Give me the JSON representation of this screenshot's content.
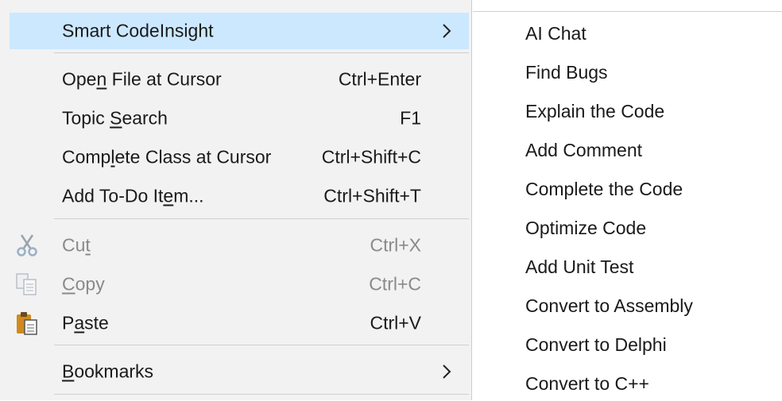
{
  "menu": {
    "smart": {
      "label_pre": "Smart CodeInsi",
      "label_u": "g",
      "label_post": "ht"
    },
    "open_file": {
      "label_pre": "Ope",
      "label_u": "n",
      "label_post": " File at Cursor",
      "shortcut": "Ctrl+Enter"
    },
    "topic_search": {
      "label_pre": "Topic ",
      "label_u": "S",
      "label_post": "earch",
      "shortcut": "F1"
    },
    "complete_class": {
      "label_pre": "Comp",
      "label_u": "l",
      "label_post": "ete Class at Cursor",
      "shortcut": "Ctrl+Shift+C"
    },
    "add_todo": {
      "label_pre": "Add To-Do It",
      "label_u": "e",
      "label_post": "m...",
      "shortcut": "Ctrl+Shift+T"
    },
    "cut": {
      "label_pre": "Cu",
      "label_u": "t",
      "label_post": "",
      "shortcut": "Ctrl+X",
      "icon": "scissors-icon"
    },
    "copy": {
      "label_pre": "",
      "label_u": "C",
      "label_post": "opy",
      "shortcut": "Ctrl+C",
      "icon": "copy-icon"
    },
    "paste": {
      "label_pre": "P",
      "label_u": "a",
      "label_post": "ste",
      "shortcut": "Ctrl+V",
      "icon": "clipboard-icon"
    },
    "bookmarks": {
      "label_pre": "",
      "label_u": "B",
      "label_post": "ookmarks"
    }
  },
  "submenu": {
    "items": [
      "AI Chat",
      "Find Bugs",
      "Explain the Code",
      "Add Comment",
      "Complete the Code",
      "Optimize Code",
      "Add Unit Test",
      "Convert to Assembly",
      "Convert to Delphi",
      "Convert to C++"
    ]
  },
  "colors": {
    "highlight": "#cce8ff",
    "menu_bg": "#f2f2f2",
    "disabled_text": "#8a8a8a",
    "separator": "#cfcfcf"
  }
}
